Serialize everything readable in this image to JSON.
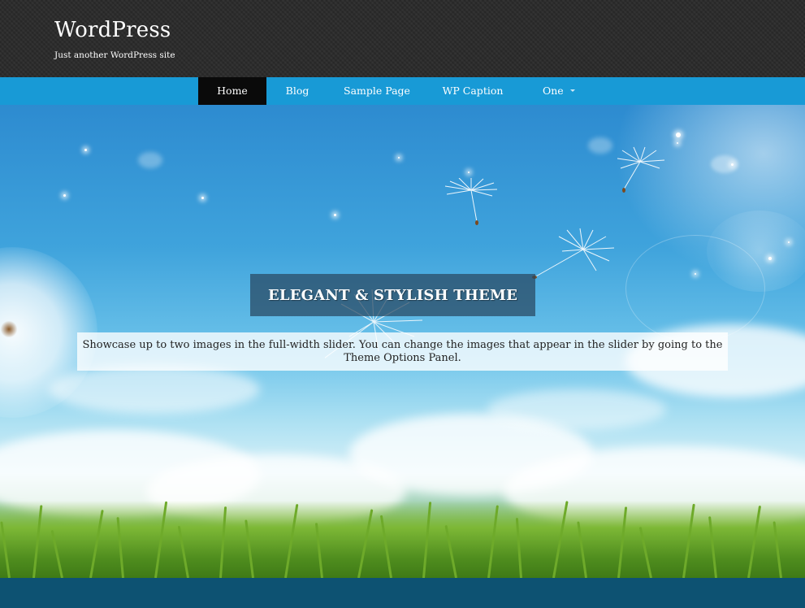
{
  "site": {
    "title": "WordPress",
    "tagline": "Just another WordPress site"
  },
  "nav": {
    "items": [
      {
        "label": "Home",
        "active": true
      },
      {
        "label": "Blog"
      },
      {
        "label": "Sample Page"
      },
      {
        "label": "WP Caption"
      },
      {
        "label": "One",
        "has_submenu": true
      }
    ]
  },
  "slider": {
    "title": "ELEGANT & STYLISH THEME",
    "caption": "Showcase up to two images in the full-width slider. You can change the images that appear in the slider by going to the Theme Options Panel."
  },
  "colors": {
    "header_bg": "#2a2a2a",
    "nav_bg": "#189ad6",
    "nav_active_bg": "#0a0a0a",
    "footer_bg": "#0d5272"
  }
}
